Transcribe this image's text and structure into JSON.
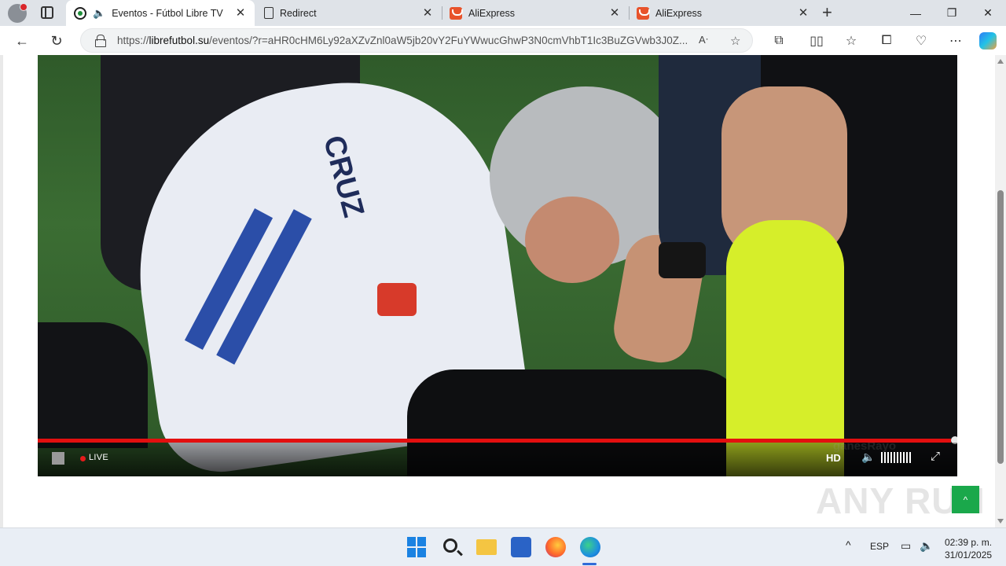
{
  "browser": {
    "tabs": [
      {
        "title": "Eventos - Fútbol Libre TV",
        "favicon": "soccer-ball-icon",
        "active": true,
        "audio": true
      },
      {
        "title": "Redirect",
        "favicon": "page-icon",
        "active": false
      },
      {
        "title": "AliExpress",
        "favicon": "aliexpress-icon",
        "active": false
      },
      {
        "title": "AliExpress",
        "favicon": "aliexpress-icon",
        "active": false
      }
    ],
    "close_glyph": "✕",
    "new_tab_glyph": "+",
    "window_controls": {
      "minimize": "—",
      "maximize": "❐",
      "close": "✕"
    },
    "address": {
      "scheme": "https://",
      "host": "librefutbol.su",
      "path": "/eventos/?r=aHR0cHM6Ly92aXZvZnl0aW5jb20vY2FuYWwucGhwP3N0cmVhbT1Ic3BuZGVwb3J0Z..."
    },
    "nav_glyphs": {
      "back": "←",
      "refresh": "↻"
    }
  },
  "player": {
    "live_label": "LIVE",
    "hd_label": "HD",
    "volume_icon": "speaker-icon",
    "fullscreen_icon": "fullscreen-icon",
    "progress": 0.993,
    "overlay_text": "ganesRayo",
    "colors": {
      "seek": "#e30f0f",
      "live_dot": "#e51b1b"
    }
  },
  "page": {
    "watermark": "ANY RUN",
    "to_top_glyph": "^"
  },
  "taskbar": {
    "language": "ESP",
    "time": "02:39 p. m.",
    "date": "31/01/2025",
    "tray_up": "^"
  }
}
